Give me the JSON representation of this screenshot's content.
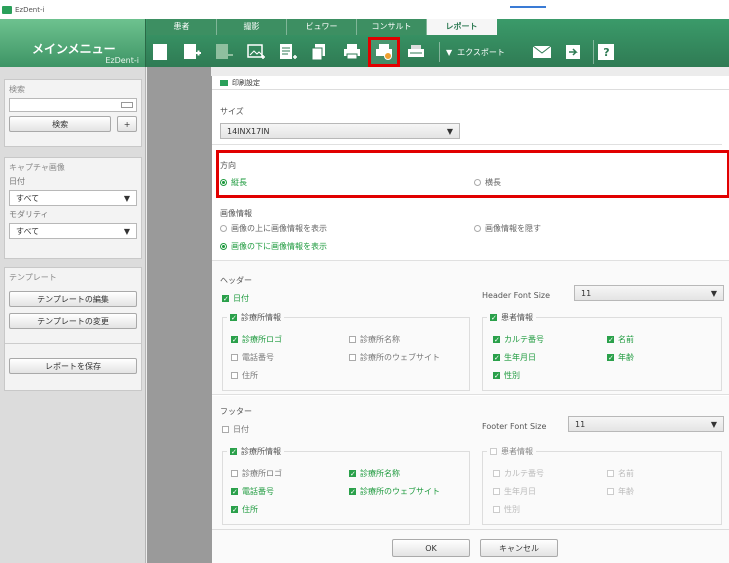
{
  "app": {
    "title": "EzDent-i"
  },
  "mainmenu": {
    "title": "メインメニュー",
    "subtitle": "EzDent-i"
  },
  "tabs": [
    "患者",
    "撮影",
    "ビュワー",
    "コンサルト",
    "レポート"
  ],
  "toolbar": {
    "export_label": "エクスポート"
  },
  "sidebar": {
    "search": {
      "label": "検索",
      "button": "検索",
      "plus": "+"
    },
    "capture": {
      "label": "キャプチャ画像",
      "date_label": "日付",
      "date_value": "すべて",
      "modality_label": "モダリティ",
      "modality_value": "すべて"
    },
    "template": {
      "label": "テンプレート",
      "edit": "テンプレートの編集",
      "change": "テンプレートの変更"
    },
    "save_report": "レポートを保存"
  },
  "dialog": {
    "title": "印刷設定",
    "size": {
      "label": "サイズ",
      "value": "14INX17IN"
    },
    "orientation": {
      "label": "方向",
      "portrait": "縦長",
      "landscape": "横長"
    },
    "image_info": {
      "label": "画像情報",
      "above": "画像の上に画像情報を表示",
      "hide": "画像情報を隠す",
      "below": "画像の下に画像情報を表示"
    },
    "header": {
      "label": "ヘッダー",
      "date": "日付",
      "font_size_label": "Header Font Size",
      "font_size_value": "11",
      "clinic": {
        "title": "診療所情報",
        "logo": "診療所ロゴ",
        "name": "診療所名称",
        "phone": "電話番号",
        "website": "診療所のウェブサイト",
        "address": "住所"
      },
      "patient": {
        "title": "患者情報",
        "chart_no": "カルテ番号",
        "name": "名前",
        "birthdate": "生年月日",
        "age": "年齢",
        "sex": "性別"
      }
    },
    "footer": {
      "label": "フッター",
      "date": "日付",
      "font_size_label": "Footer Font Size",
      "font_size_value": "11",
      "clinic": {
        "title": "診療所情報",
        "logo": "診療所ロゴ",
        "name": "診療所名称",
        "phone": "電話番号",
        "website": "診療所のウェブサイト",
        "address": "住所"
      },
      "patient": {
        "title": "患者情報",
        "chart_no": "カルテ番号",
        "name": "名前",
        "birthdate": "生年月日",
        "age": "年齢",
        "sex": "性別"
      }
    },
    "ok": "OK",
    "cancel": "キャンセル"
  },
  "icons": [
    "new-report-icon",
    "add-template-icon",
    "delete-icon",
    "add-image-icon",
    "add-text-icon",
    "copy-icon",
    "print-icon",
    "print-settings-icon",
    "scanner-icon",
    "mail-icon",
    "share-icon",
    "help-icon"
  ],
  "colors": {
    "accent_green": "#2f7b54",
    "check_green": "#1f9b3f",
    "highlight_red": "#e10000"
  }
}
